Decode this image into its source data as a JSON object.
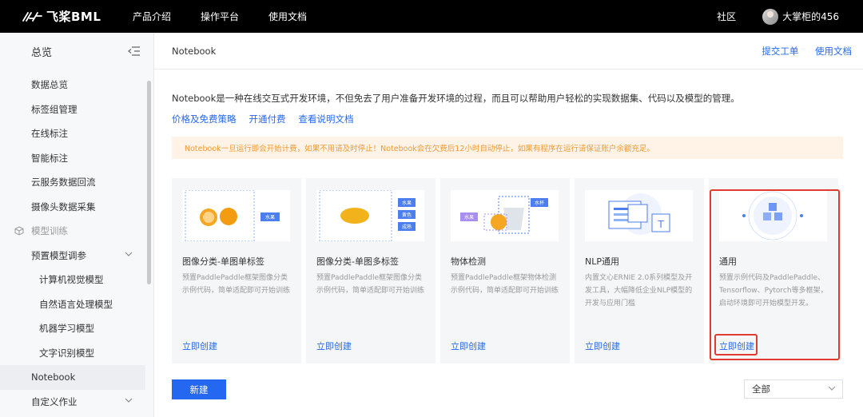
{
  "topbar": {
    "brand": "飞桨BML",
    "nav": [
      "产品介绍",
      "操作平台",
      "使用文档"
    ],
    "community": "社区",
    "username": "大掌柜的456"
  },
  "sidebar": {
    "title": "总览",
    "items": [
      {
        "label": "数据总览",
        "type": "item"
      },
      {
        "label": "标签组管理",
        "type": "item"
      },
      {
        "label": "在线标注",
        "type": "item"
      },
      {
        "label": "智能标注",
        "type": "item"
      },
      {
        "label": "云服务数据回流",
        "type": "item"
      },
      {
        "label": "摄像头数据采集",
        "type": "item"
      },
      {
        "label": "模型训练",
        "type": "group"
      },
      {
        "label": "预置模型调参",
        "type": "item"
      },
      {
        "label": "计算机视觉模型",
        "type": "sub"
      },
      {
        "label": "自然语言处理模型",
        "type": "sub"
      },
      {
        "label": "机器学习模型",
        "type": "sub"
      },
      {
        "label": "文字识别模型",
        "type": "sub"
      },
      {
        "label": "Notebook",
        "type": "item"
      },
      {
        "label": "自定义作业",
        "type": "item"
      }
    ]
  },
  "header": {
    "title": "Notebook",
    "ticket_link": "提交工单",
    "docs_link": "使用文档"
  },
  "intro": {
    "description": "Notebook是一种在线交互式开发环境，不但免去了用户准备开发环境的过程，而且可以帮助用户轻松的实现数据集、代码以及模型的管理。",
    "links": [
      "价格及免费策略",
      "开通付费",
      "查看说明文档"
    ]
  },
  "notice": "Notebook一旦运行即会开始计费，如果不用请及时停止！Notebook会在欠费后12小时自动停止，如果有程序在运行请保证账户余额充足。",
  "cards": [
    {
      "title": "图像分类-单图单标签",
      "description": "预置PaddlePaddle框架图像分类示例代码，简单适配即可开始训练",
      "create": "立即创建",
      "tags": [
        "水果"
      ]
    },
    {
      "title": "图像分类-单图多标签",
      "description": "预置PaddlePaddle框架图像分类示例代码，简单适配即可开始训练",
      "create": "立即创建",
      "tags": [
        "水果",
        "黄色",
        "成熟"
      ]
    },
    {
      "title": "物体检测",
      "description": "预置PaddlePaddle框架物体检测示例代码，简单适配即可开始训练",
      "create": "立即创建",
      "tags": [
        "水杯",
        "水果"
      ]
    },
    {
      "title": "NLP通用",
      "description": "内置文心ERNIE 2.0系列模型及开发工具，大幅降低企业NLP模型的开发与应用门槛",
      "create": "立即创建",
      "tags": [
        "T"
      ]
    },
    {
      "title": "通用",
      "description": "预置示例代码及PaddlePaddle、Tensorflow、Pytorch等多框架，启动环境即可开始模型开发。",
      "create": "立即创建",
      "tags": []
    }
  ],
  "actions": {
    "new_button": "新建",
    "filter_selected": "全部"
  },
  "colors": {
    "accent": "#2468f2",
    "notice_bg": "#fef3e6",
    "notice_text": "#f39a33",
    "highlight": "#e03b2e"
  }
}
